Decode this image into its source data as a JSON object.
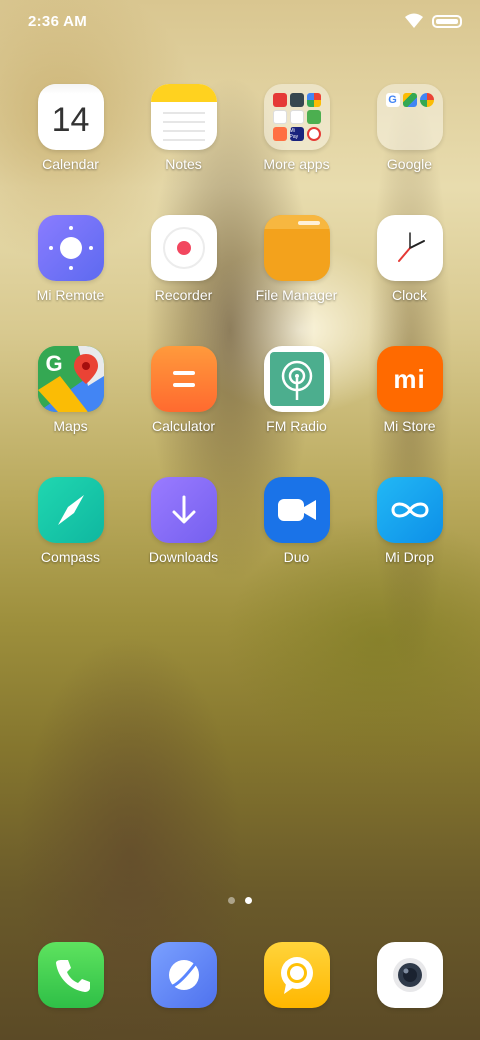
{
  "status_bar": {
    "time": "2:36 AM"
  },
  "apps": [
    {
      "id": "calendar",
      "label": "Calendar",
      "icon": "calendar-icon",
      "text": "14"
    },
    {
      "id": "notes",
      "label": "Notes",
      "icon": "notes-icon"
    },
    {
      "id": "more-apps",
      "label": "More apps",
      "icon": "folder-icon",
      "text": "Mi Pay"
    },
    {
      "id": "google",
      "label": "Google",
      "icon": "google-folder-icon"
    },
    {
      "id": "mi-remote",
      "label": "Mi Remote",
      "icon": "mi-remote-icon"
    },
    {
      "id": "recorder",
      "label": "Recorder",
      "icon": "recorder-icon"
    },
    {
      "id": "file-manager",
      "label": "File Manager",
      "icon": "file-manager-icon"
    },
    {
      "id": "clock",
      "label": "Clock",
      "icon": "clock-icon"
    },
    {
      "id": "maps",
      "label": "Maps",
      "icon": "maps-icon",
      "text": "G"
    },
    {
      "id": "calculator",
      "label": "Calculator",
      "icon": "calculator-icon"
    },
    {
      "id": "fm-radio",
      "label": "FM Radio",
      "icon": "fm-radio-icon"
    },
    {
      "id": "mi-store",
      "label": "Mi Store",
      "icon": "mi-store-icon",
      "text": "mi"
    },
    {
      "id": "compass",
      "label": "Compass",
      "icon": "compass-icon"
    },
    {
      "id": "downloads",
      "label": "Downloads",
      "icon": "downloads-icon"
    },
    {
      "id": "duo",
      "label": "Duo",
      "icon": "duo-icon"
    },
    {
      "id": "mi-drop",
      "label": "Mi Drop",
      "icon": "mi-drop-icon"
    }
  ],
  "dock": [
    {
      "id": "phone",
      "icon": "phone-icon"
    },
    {
      "id": "browser",
      "icon": "browser-icon"
    },
    {
      "id": "messaging",
      "icon": "messaging-icon"
    },
    {
      "id": "camera",
      "icon": "camera-icon"
    }
  ],
  "page_indicator": {
    "pages": 2,
    "current": 2
  },
  "colors": {
    "notes_yellow": "#ffd21f",
    "mi_remote": "#7b6df5",
    "recorder_red": "#f2475f",
    "file_manager": "#f3a21c",
    "calculator": "#ff7a33",
    "fm_radio": "#4cae8e",
    "mi_store": "#ff6a00",
    "compass": "#12c9a8",
    "downloads": "#8a6bf2",
    "duo": "#1a73e8",
    "mi_drop": "#14a6f2",
    "phone": "#3ccf4e",
    "browser": "#5a86ff",
    "messaging": "#ffc107",
    "camera_white": "#ffffff"
  }
}
